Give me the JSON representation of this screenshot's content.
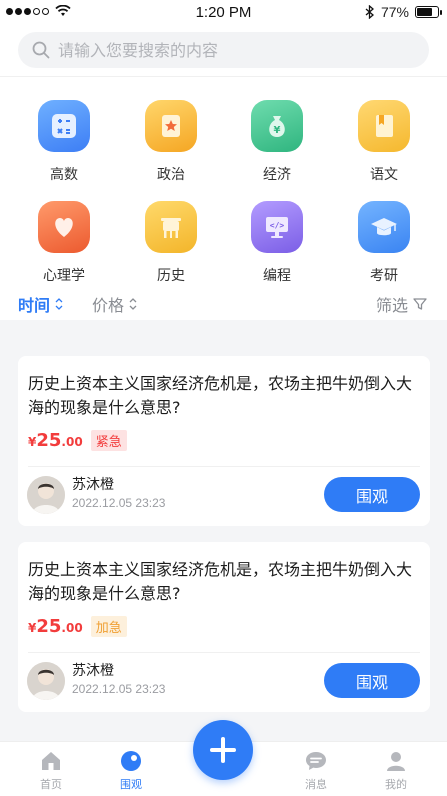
{
  "status_bar": {
    "time": "1:20 PM",
    "battery": "77%",
    "battery_level": 0.77
  },
  "search": {
    "placeholder": "请输入您要搜索的内容"
  },
  "categories": [
    {
      "label": "高数",
      "icon": "calculator-icon",
      "color": "#3d86f5"
    },
    {
      "label": "政治",
      "icon": "star-book-icon",
      "color": "#f7b733"
    },
    {
      "label": "经济",
      "icon": "money-bag-icon",
      "color": "#3ec28f"
    },
    {
      "label": "语文",
      "icon": "book-icon",
      "color": "#f7c13a"
    },
    {
      "label": "心理学",
      "icon": "heart-icon",
      "color": "#f06a3b"
    },
    {
      "label": "历史",
      "icon": "bronze-vessel-icon",
      "color": "#f5c43a"
    },
    {
      "label": "编程",
      "icon": "code-monitor-icon",
      "color": "#8a6fe8"
    },
    {
      "label": "考研",
      "icon": "graduation-cap-icon",
      "color": "#3d8ff7"
    }
  ],
  "filters": {
    "time": "时间",
    "price": "价格",
    "filter": "筛选"
  },
  "questions": [
    {
      "title": "历史上资本主义国家经济危机是，农场主把牛奶倒入大海的现象是什么意思?",
      "currency": "¥",
      "price_int": "25",
      "price_dec": ".00",
      "tag": "紧急",
      "user": "苏沐橙",
      "time": "2022.12.05 23:23",
      "button": "围观"
    },
    {
      "title": "历史上资本主义国家经济危机是，农场主把牛奶倒入大海的现象是什么意思?",
      "currency": "¥",
      "price_int": "25",
      "price_dec": ".00",
      "tag": "加急",
      "user": "苏沐橙",
      "time": "2022.12.05 23:23",
      "button": "围观"
    }
  ],
  "tabs": [
    {
      "label": "首页",
      "icon": "home-icon"
    },
    {
      "label": "围观",
      "icon": "watch-icon",
      "active": true
    },
    {
      "label": "消息",
      "icon": "message-icon"
    },
    {
      "label": "我的",
      "icon": "user-icon"
    }
  ],
  "colors": {
    "primary": "#2f7cf6",
    "price": "#f23c3c"
  }
}
